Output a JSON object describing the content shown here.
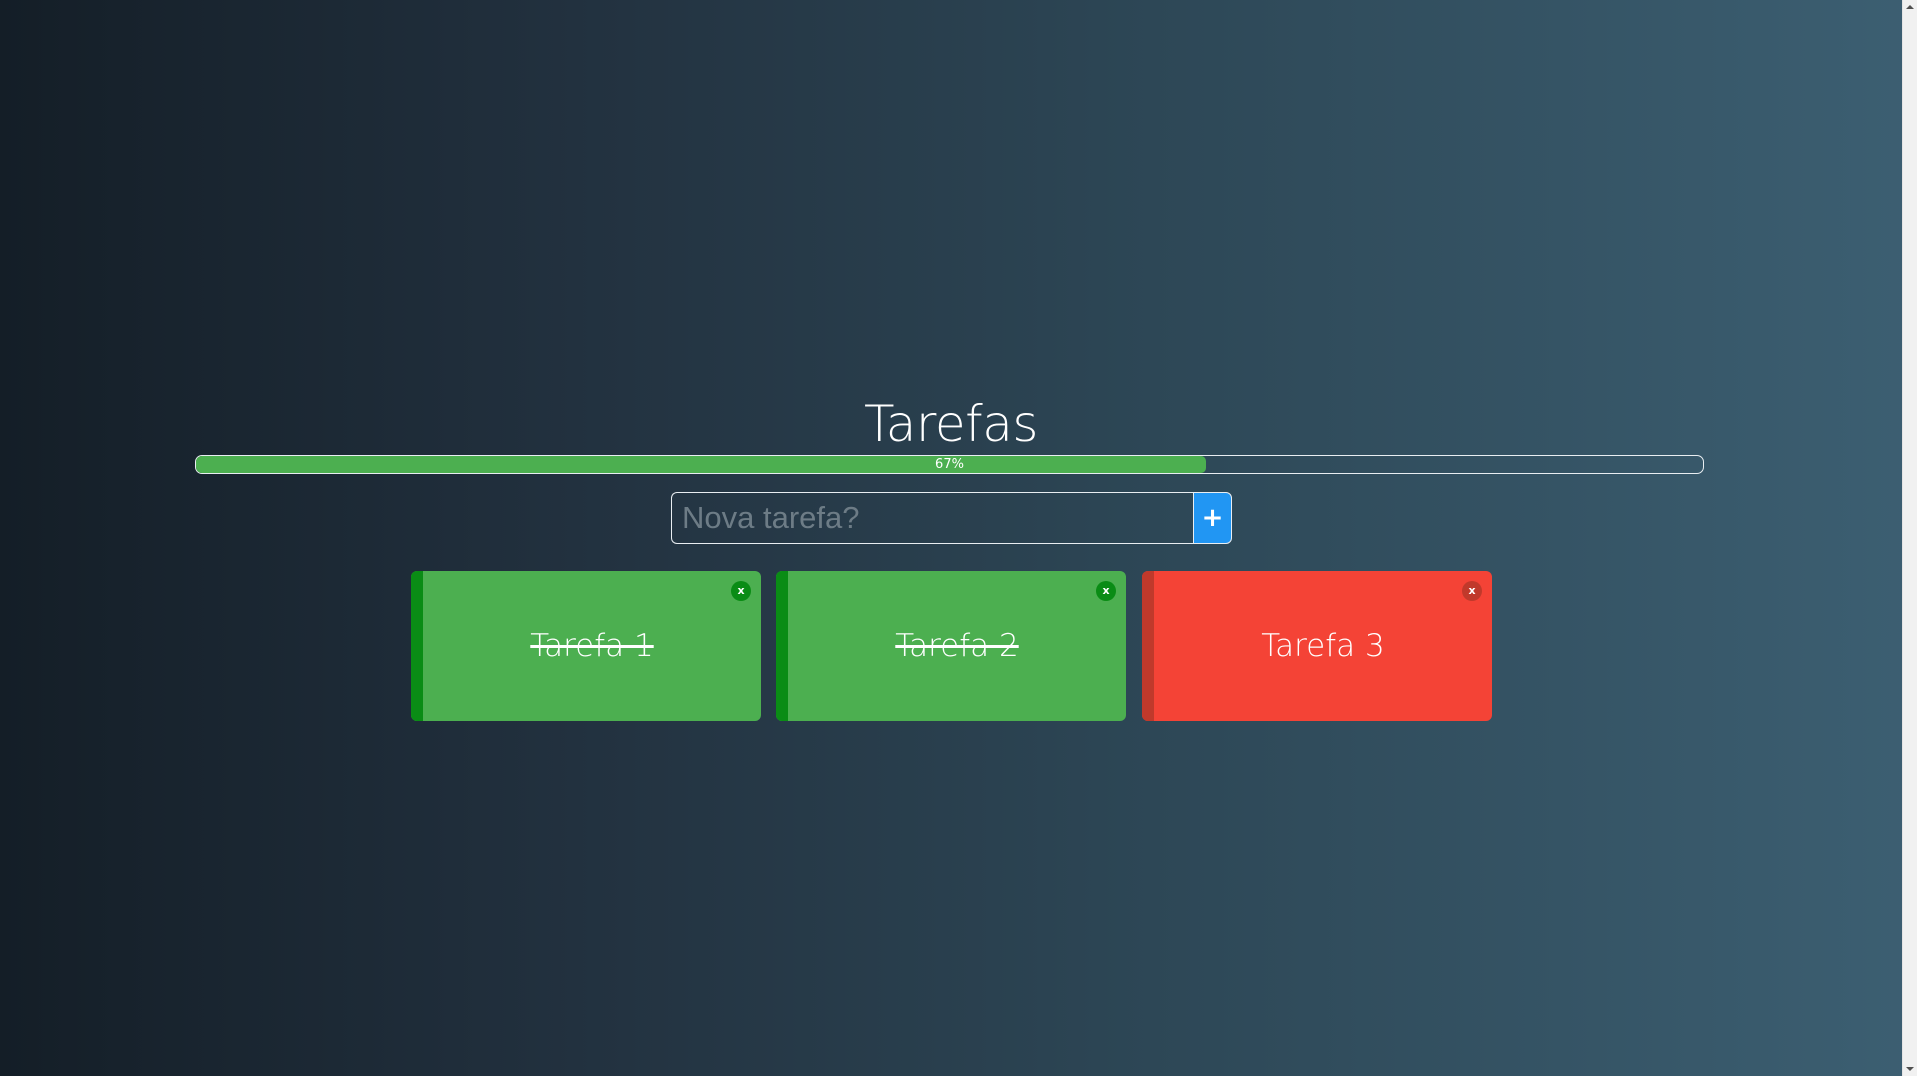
{
  "header": {
    "title": "Tarefas"
  },
  "progress": {
    "value_fraction": 0.67,
    "label": "67%",
    "fill_color": "#4caf50"
  },
  "new_task": {
    "placeholder": "Nova tarefa?",
    "value": "",
    "add_label": "+",
    "add_color": "#2196f3"
  },
  "tasks": [
    {
      "label": "Tarefa 1",
      "done": true,
      "close_label": "x",
      "color": "#4caf50",
      "stripe_color": "#0a8c15",
      "close_color": "#0a8c15"
    },
    {
      "label": "Tarefa 2",
      "done": true,
      "close_label": "x",
      "color": "#4caf50",
      "stripe_color": "#0a8c15",
      "close_color": "#0a8c15"
    },
    {
      "label": "Tarefa 3",
      "done": false,
      "close_label": "x",
      "color": "#f44336",
      "stripe_color": "#c0392b",
      "close_color": "#c0392b"
    }
  ]
}
